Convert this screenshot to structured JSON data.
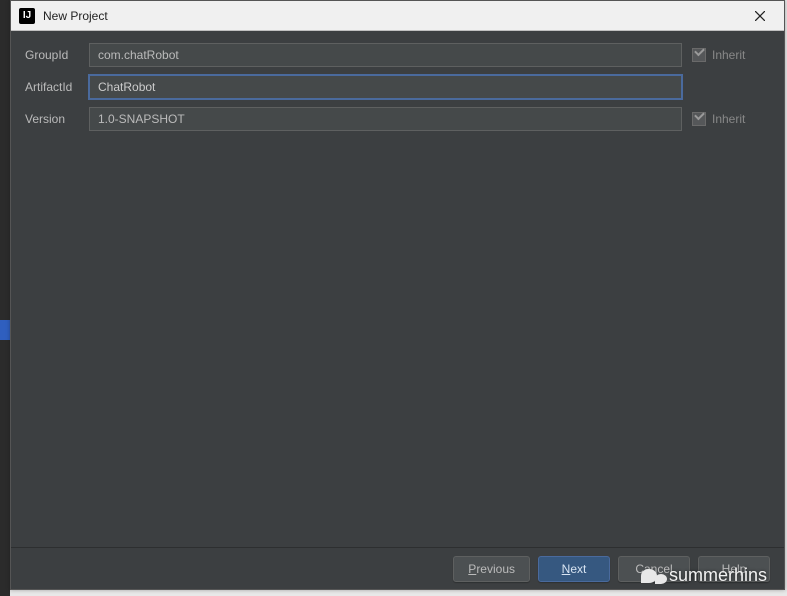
{
  "window": {
    "title": "New Project",
    "app_icon_text": "IJ"
  },
  "form": {
    "groupid_label": "GroupId",
    "groupid_value": "com.chatRobot",
    "artifactid_label": "ArtifactId",
    "artifactid_value": "ChatRobot",
    "version_label": "Version",
    "version_value": "1.0-SNAPSHOT",
    "inherit_label": "Inherit"
  },
  "buttons": {
    "previous": "Previous",
    "next": "Next",
    "cancel": "Cancel",
    "help": "Help"
  },
  "watermark": "summerhins"
}
